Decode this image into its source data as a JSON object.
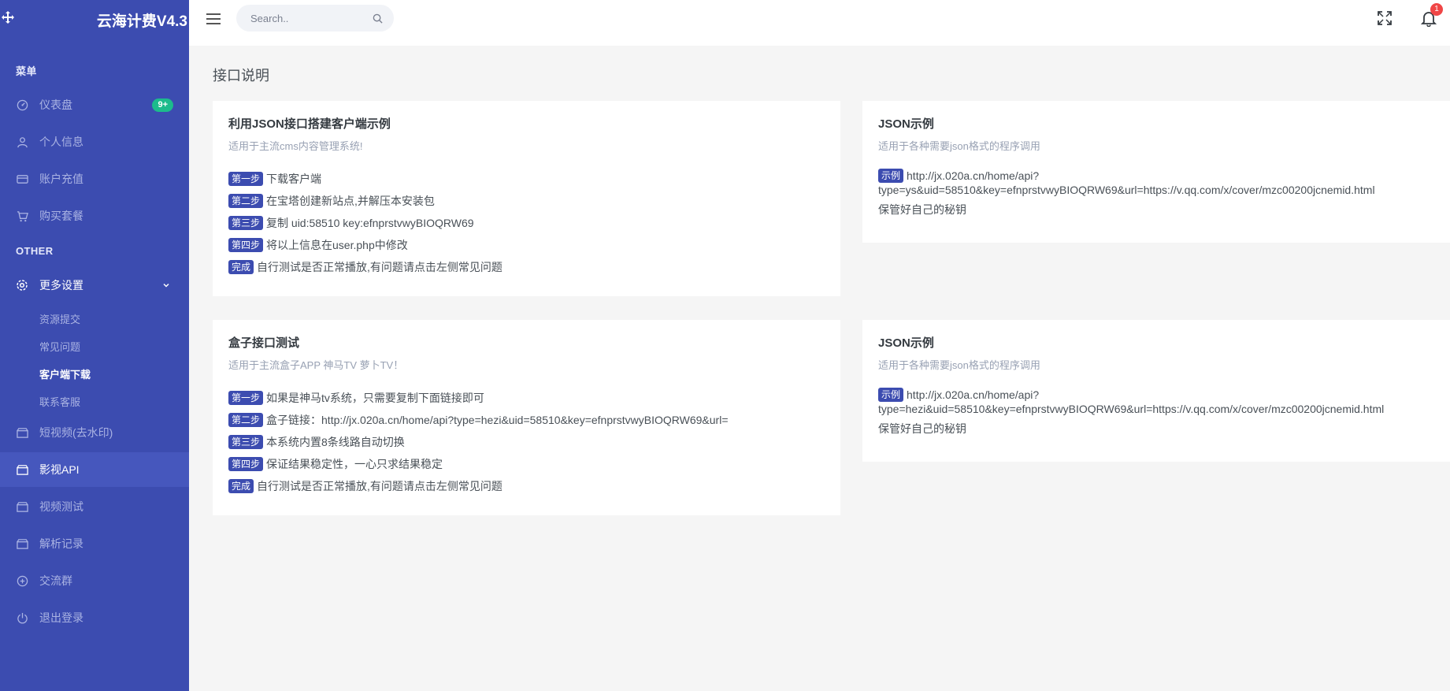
{
  "brand": {
    "title": "云海计费V4.3"
  },
  "sidebar": {
    "section_menu": "菜单",
    "section_other": "OTHER",
    "items": {
      "dashboard": {
        "label": "仪表盘",
        "badge": "9+"
      },
      "profile": {
        "label": "个人信息"
      },
      "recharge": {
        "label": "账户充值"
      },
      "buy": {
        "label": "购买套餐"
      },
      "settings": {
        "label": "更多设置"
      },
      "short_video": {
        "label": "短视频(去水印)"
      },
      "api": {
        "label": "影视API"
      },
      "video_test": {
        "label": "视频测试"
      },
      "records": {
        "label": "解析记录"
      },
      "group": {
        "label": "交流群"
      },
      "logout": {
        "label": "退出登录"
      }
    },
    "sub_items": [
      "资源提交",
      "常见问题",
      "客户端下载",
      "联系客服"
    ]
  },
  "topbar": {
    "search_placeholder": "Search..",
    "notification_count": "1"
  },
  "page": {
    "title": "接口说明"
  },
  "cards": {
    "client": {
      "title": "利用JSON接口搭建客户端示例",
      "subtitle": "适用于主流cms内容管理系统!",
      "steps": [
        {
          "tag": "第一步",
          "text": "下载客户端"
        },
        {
          "tag": "第二步",
          "text": "在宝塔创建新站点,并解压本安装包"
        },
        {
          "tag": "第三步",
          "text": "复制 uid:58510 key:efnprstvwyBIOQRW69"
        },
        {
          "tag": "第四步",
          "text": "将以上信息在user.php中修改"
        },
        {
          "tag": "完成",
          "text": "自行测试是否正常播放,有问题请点击左侧常见问题"
        }
      ]
    },
    "json1": {
      "title": "JSON示例",
      "subtitle": "适用于各种需要json格式的程序调用",
      "tag": "示例",
      "line1": "http://jx.020a.cn/home/api?",
      "line2": "type=ys&uid=58510&key=efnprstvwyBIOQRW69&url=https://v.qq.com/x/cover/mzc00200jcnemid.html",
      "note": "保管好自己的秘钥"
    },
    "box": {
      "title": "盒子接口测试",
      "subtitle": "适用于主流盒子APP 神马TV 萝卜TV！",
      "steps": [
        {
          "tag": "第一步",
          "text": "如果是神马tv系统，只需要复制下面链接即可"
        },
        {
          "tag": "第二步",
          "text": "盒子链接：http://jx.020a.cn/home/api?type=hezi&uid=58510&key=efnprstvwyBIOQRW69&url="
        },
        {
          "tag": "第三步",
          "text": "本系统内置8条线路自动切换"
        },
        {
          "tag": "第四步",
          "text": "保证结果稳定性，一心只求结果稳定"
        },
        {
          "tag": "完成",
          "text": "自行测试是否正常播放,有问题请点击左侧常见问题"
        }
      ]
    },
    "json2": {
      "title": "JSON示例",
      "subtitle": "适用于各种需要json格式的程序调用",
      "tag": "示例",
      "line1": "http://jx.020a.cn/home/api?",
      "line2": "type=hezi&uid=58510&key=efnprstvwyBIOQRW69&url=https://v.qq.com/x/cover/mzc00200jcnemid.html",
      "note": "保管好自己的秘钥"
    }
  }
}
